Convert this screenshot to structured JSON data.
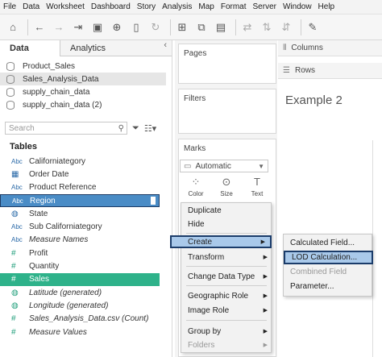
{
  "menubar": {
    "items": [
      "File",
      "Data",
      "Worksheet",
      "Dashboard",
      "Story",
      "Analysis",
      "Map",
      "Format",
      "Server",
      "Window",
      "Help"
    ]
  },
  "toolbar": {
    "icons": [
      "home-icon",
      "back-icon",
      "forward-icon",
      "redo-icon",
      "save-icon",
      "new-datasource-icon",
      "pause-icon",
      "refresh-icon",
      "new-sheet-icon",
      "duplicate-sheet-icon",
      "clear-sheet-icon",
      "swap-icon",
      "sort-asc-icon",
      "sort-desc-icon",
      "highlight-icon"
    ]
  },
  "left_panel": {
    "tabs": [
      {
        "label": "Data",
        "active": true
      },
      {
        "label": "Analytics",
        "active": false
      }
    ],
    "close_glyph": "‹",
    "data_sources": [
      {
        "label": "Product_Sales",
        "selected": false
      },
      {
        "label": "Sales_Analysis_Data",
        "selected": true
      },
      {
        "label": "supply_chain_data",
        "selected": false
      },
      {
        "label": "supply_chain_data (2)",
        "selected": false
      }
    ],
    "search": {
      "placeholder": "Search"
    },
    "tables_title": "Tables",
    "fields": [
      {
        "type": "Abc",
        "label": "Californiategory",
        "italic": false
      },
      {
        "type": "date",
        "label": "Order Date",
        "italic": false
      },
      {
        "type": "Abc",
        "label": "Product Reference",
        "italic": false
      },
      {
        "type": "Abc",
        "label": "Region",
        "italic": false
      },
      {
        "type": "geo",
        "label": "State",
        "italic": false
      },
      {
        "type": "Abc",
        "label": "Sub Californiategory",
        "italic": false
      },
      {
        "type": "Abc",
        "label": "Measure Names",
        "italic": true
      },
      {
        "type": "#",
        "label": "Profit",
        "italic": false
      },
      {
        "type": "#",
        "label": "Quantity",
        "italic": false
      },
      {
        "type": "#",
        "label": "Sales",
        "italic": false
      },
      {
        "type": "geo",
        "label": "Latitude (generated)",
        "italic": true
      },
      {
        "type": "geo",
        "label": "Longitude (generated)",
        "italic": true
      },
      {
        "type": "#",
        "label": "Sales_Analysis_Data.csv (Count)",
        "italic": true
      },
      {
        "type": "#",
        "label": "Measure Values",
        "italic": true
      }
    ]
  },
  "mid_panel": {
    "pages_title": "Pages",
    "filters_title": "Filters",
    "marks_title": "Marks",
    "marks_type": "Automatic",
    "mark_buttons": [
      "Color",
      "Size",
      "Text"
    ]
  },
  "right_area": {
    "columns_label": "Columns",
    "rows_label": "Rows",
    "sheet_title": "Example 2"
  },
  "context_menu": {
    "items": [
      "Duplicate",
      "Hide",
      "Create",
      "Transform",
      "Change Data Type",
      "Geographic Role",
      "Image Role",
      "Group by",
      "Folders"
    ]
  },
  "submenu": {
    "items": [
      "Calculated Field...",
      "LOD Calculation...",
      "Combined Field",
      "Parameter..."
    ]
  },
  "colors": {
    "highlight": "#a9c9ea",
    "region_bg": "#4a8cc6",
    "sales_bg": "#2eb28a"
  }
}
